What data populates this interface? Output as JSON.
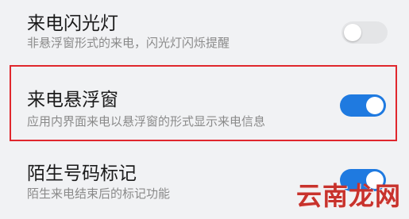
{
  "settings": {
    "flash": {
      "title": "来电闪光灯",
      "subtitle": "非悬浮窗形式的来电，闪光灯闪烁提醒",
      "enabled": false
    },
    "floating_window": {
      "title": "来电悬浮窗",
      "subtitle": "应用内界面来电以悬浮窗的形式显示来电信息",
      "enabled": true
    },
    "number_tag": {
      "title": "陌生号码标记",
      "subtitle": "陌生来电结束后的标记功能",
      "enabled": true
    }
  },
  "watermark": "云南龙网",
  "colors": {
    "toggle_on": "#1f7ae0",
    "toggle_off": "#e4e5e7",
    "highlight": "#e0272d",
    "watermark": "#c8322c"
  }
}
